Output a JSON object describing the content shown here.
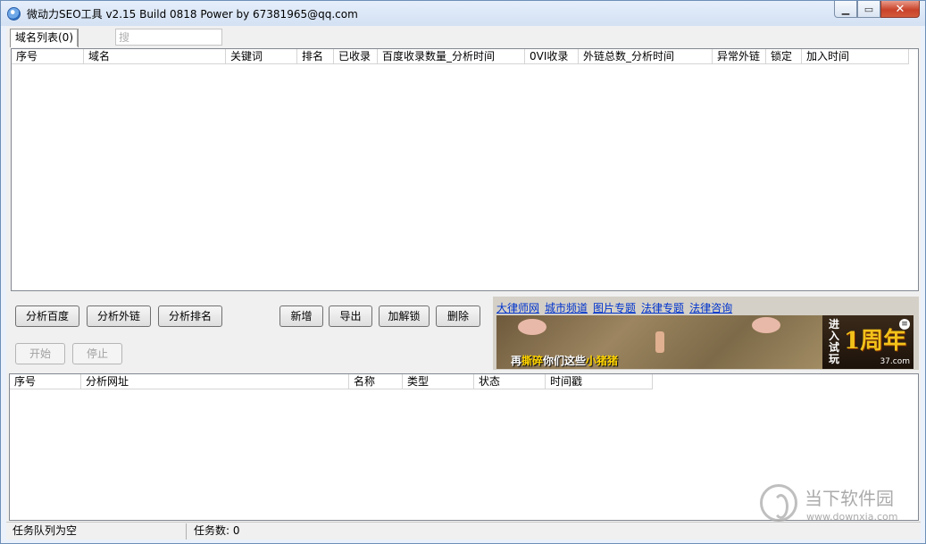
{
  "window": {
    "title": "微动力SEO工具 v2.15 Build 0818 Power by 67381965@qq.com",
    "minimize_icon": "minimize-icon",
    "maximize_icon": "maximize-icon",
    "close_icon": "close-icon",
    "minimize_glyph": "▁",
    "maximize_glyph": "▭",
    "close_glyph": "✕"
  },
  "tabs": [
    {
      "label": "域名列表(0)",
      "active": true
    }
  ],
  "search": {
    "placeholder": "搜",
    "value": ""
  },
  "domain_table": {
    "columns": [
      "序号",
      "域名",
      "关键词",
      "排名",
      "已收录",
      "百度收录数量_分析时间",
      "0VI收录",
      "外链总数_分析时间",
      "异常外链",
      "锁定",
      "加入时间"
    ],
    "rows": []
  },
  "buttons": {
    "analyze_baidu": "分析百度",
    "analyze_links": "分析外链",
    "analyze_rank": "分析排名",
    "add": "新增",
    "export": "导出",
    "lock_unlock": "加解锁",
    "delete": "删除",
    "start": "开始",
    "stop": "停止"
  },
  "ad": {
    "links": [
      "大律师网",
      "城市频道",
      "图片专题",
      "法律专题",
      "法律咨询"
    ],
    "caption_prefix": "再",
    "caption_highlight1": "撕碎",
    "caption_middle": "你们这些",
    "caption_highlight2": "小猪猪",
    "side_text": "进入试玩",
    "side_big": "1周年",
    "side_site": "37.com",
    "side_badge": "≡"
  },
  "task_table": {
    "columns": [
      "序号",
      "分析网址",
      "名称",
      "类型",
      "状态",
      "时间戳"
    ],
    "rows": []
  },
  "status": {
    "queue": "任务队列为空",
    "task_count": "任务数: 0"
  },
  "watermark": {
    "name": "当下软件园",
    "url": "www.downxia.com"
  },
  "colors": {
    "title_bar": "#d3e1f3",
    "close_button": "#c8432a",
    "link": "#0033cc"
  }
}
